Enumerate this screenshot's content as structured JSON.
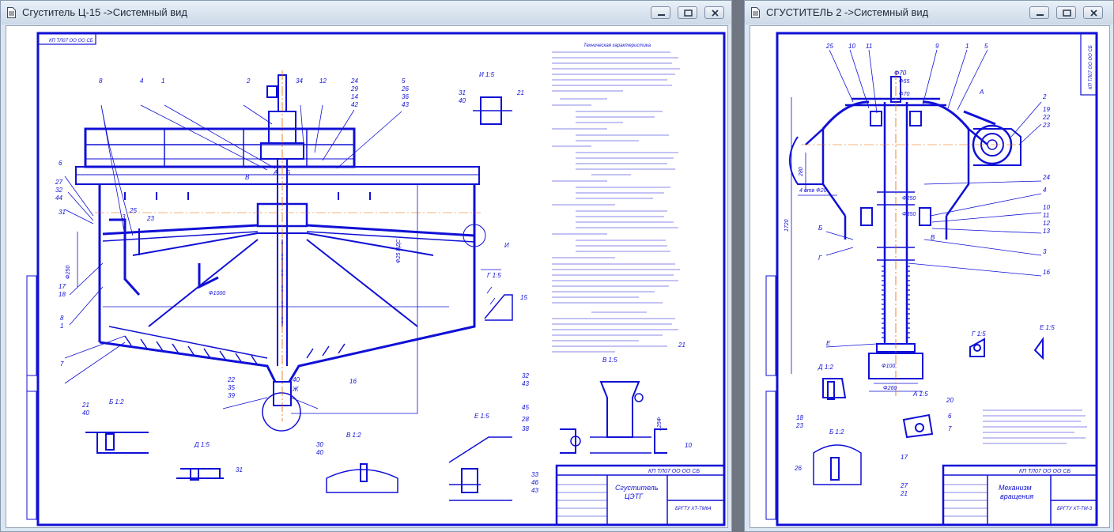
{
  "windows": [
    {
      "title": "Сгуститель Ц-15 ->Системный вид",
      "drawing": {
        "stamp_code": "КП ТЛ07 ОО ОО СБ",
        "name_line1": "Сгуститель",
        "name_line2": "ЦЭТГ",
        "org": "БРГТУ ХТ-ТМ64",
        "dims": [
          "Ф1000",
          "Ф25 НДС",
          "Ф250",
          "125Ф"
        ],
        "callouts": [
          "6",
          "8",
          "4",
          "1",
          "2",
          "3",
          "7",
          "5",
          "9",
          "10",
          "11",
          "12",
          "14",
          "15",
          "16",
          "17",
          "18",
          "19",
          "20",
          "21",
          "22",
          "23",
          "24",
          "25",
          "27",
          "28",
          "29",
          "31",
          "32",
          "33",
          "36",
          "38",
          "39",
          "40",
          "41",
          "42",
          "43",
          "44",
          "46",
          "И",
          "Ж",
          "А",
          "Б",
          "В",
          "Г"
        ],
        "notes_title": "Техническая характеристика",
        "views": [
          "И 1:5",
          "А 1:2",
          "Б 1:2",
          "В 1:2",
          "Г 1:5",
          "Д 1:5",
          "Ж 1:5",
          "Е 1:5"
        ]
      }
    },
    {
      "title": "СГУСТИТЕЛЬ 2 ->Системный вид",
      "drawing": {
        "stamp_code": "КП ТЛ07 ОО ОО СБ",
        "name_line1": "Механизм",
        "name_line2": "вращения",
        "org": "БРГТУ ХТ-ТМ-3",
        "dims": [
          "Ф70",
          "Ф55",
          "Ф70",
          "Ф250",
          "Ф350",
          "Ф390",
          "Ф100",
          "Ф260",
          "1720",
          "280",
          "4 отв Ф20"
        ],
        "callouts": [
          "1",
          "2",
          "3",
          "4",
          "5",
          "7",
          "8",
          "9",
          "10",
          "11",
          "12",
          "13",
          "14",
          "16",
          "17",
          "18",
          "19",
          "20",
          "21",
          "22",
          "23",
          "24",
          "25",
          "26",
          "А",
          "Б",
          "В",
          "Г",
          "Д",
          "Е"
        ],
        "views": [
          "Д 1:2",
          "Е 1:2",
          "Б 1:2",
          "А 1:5",
          "В 1:5",
          "Г 1:5"
        ]
      }
    }
  ],
  "controls": [
    "minimize",
    "restore",
    "close"
  ],
  "colors": {
    "line": "#1010d6",
    "axis": "#e36b00",
    "titlebar": "#dbe6f2",
    "background": "#6f7681"
  }
}
